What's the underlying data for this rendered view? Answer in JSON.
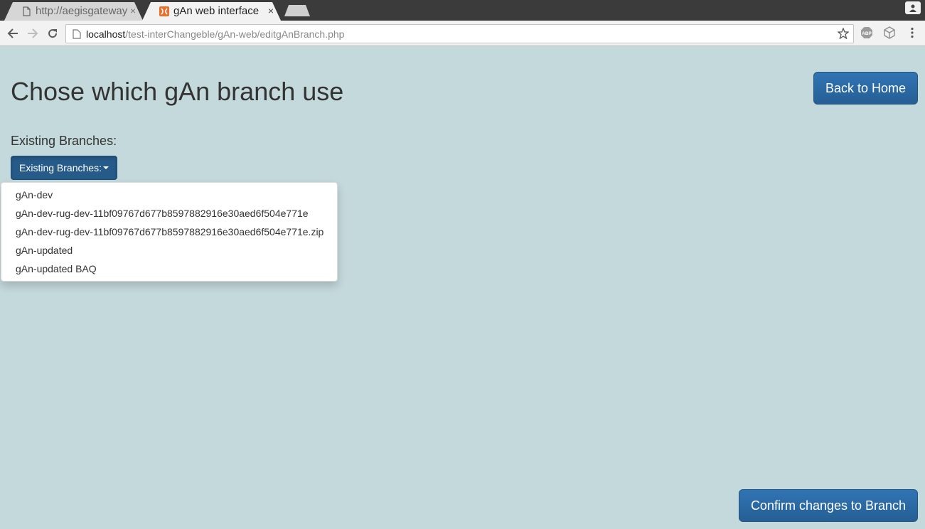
{
  "browser": {
    "tabs": [
      {
        "title": "http://aegisgateway",
        "close": "×"
      },
      {
        "title": "gAn web interface",
        "close": "×"
      }
    ],
    "url_host": "localhost",
    "url_path": "/test-interChangeble/gAn-web/editgAnBranch.php",
    "extensions": [
      "abp-icon",
      "cube-icon"
    ],
    "extension_labels": {
      "abp": "ABP"
    }
  },
  "page": {
    "title": "Chose which gAn branch use",
    "back_home_label": "Back to Home",
    "section_label": "Existing Branches:",
    "dropdown": {
      "toggle_label": "Existing Branches:",
      "items": [
        "gAn-dev",
        "gAn-dev-rug-dev-11bf09767d677b8597882916e30aed6f504e771e",
        "gAn-dev-rug-dev-11bf09767d677b8597882916e30aed6f504e771e.zip",
        "gAn-updated",
        "gAn-updated BAQ"
      ]
    },
    "confirm_label": "Confirm changes to Branch"
  },
  "colors": {
    "page_background": "#c4d9dc",
    "primary_button": "#2a6aa4",
    "active_toggle": "#265a88"
  }
}
